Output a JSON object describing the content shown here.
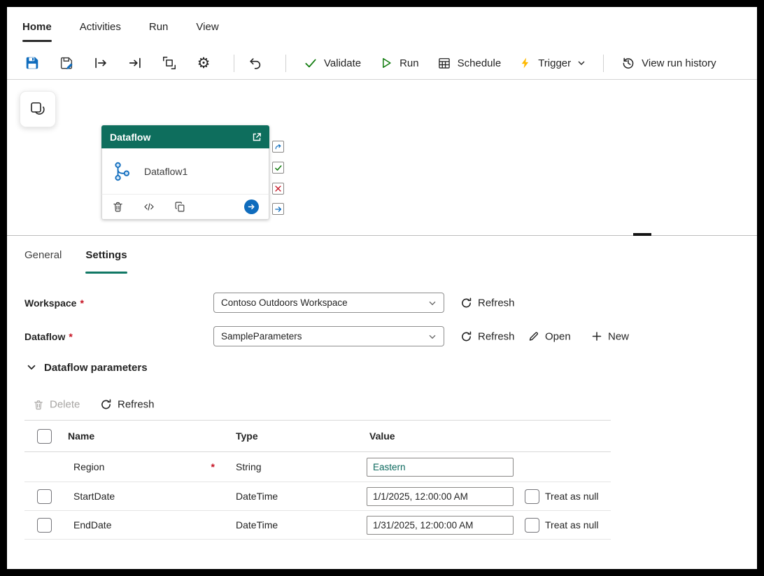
{
  "menu": {
    "items": [
      {
        "label": "Home",
        "active": true
      },
      {
        "label": "Activities",
        "active": false
      },
      {
        "label": "Run",
        "active": false
      },
      {
        "label": "View",
        "active": false
      }
    ]
  },
  "toolbar": {
    "validate": "Validate",
    "run": "Run",
    "schedule": "Schedule",
    "trigger": "Trigger",
    "view_run_history": "View run history"
  },
  "canvas": {
    "activity": {
      "type_label": "Dataflow",
      "name": "Dataflow1"
    }
  },
  "panel": {
    "tabs": [
      {
        "label": "General",
        "active": false
      },
      {
        "label": "Settings",
        "active": true
      }
    ],
    "required_marker": "*",
    "workspace": {
      "label": "Workspace",
      "value": "Contoso Outdoors Workspace",
      "refresh": "Refresh"
    },
    "dataflow": {
      "label": "Dataflow",
      "value": "SampleParameters",
      "refresh": "Refresh",
      "open": "Open",
      "new": "New"
    },
    "parameters": {
      "title": "Dataflow parameters",
      "delete": "Delete",
      "refresh": "Refresh",
      "columns": {
        "name": "Name",
        "type": "Type",
        "value": "Value"
      },
      "treat_as_null": "Treat as null",
      "rows": [
        {
          "name": "Region",
          "required": "*",
          "type": "String",
          "value": "Eastern"
        },
        {
          "name": "StartDate",
          "type": "DateTime",
          "value": "1/1/2025, 12:00:00 AM"
        },
        {
          "name": "EndDate",
          "type": "DateTime",
          "value": "1/31/2025, 12:00:00 AM"
        }
      ]
    }
  },
  "icons": {
    "gear": "⚙"
  },
  "colors": {
    "activity_header": "#0e6e5d",
    "accent_blue": "#0f6cbd",
    "success_green": "#0e7a0b",
    "error_red": "#c50f1f",
    "trigger_yellow": "#ffb900",
    "tab_underline": "#117865",
    "required_red": "#c50f1f"
  }
}
